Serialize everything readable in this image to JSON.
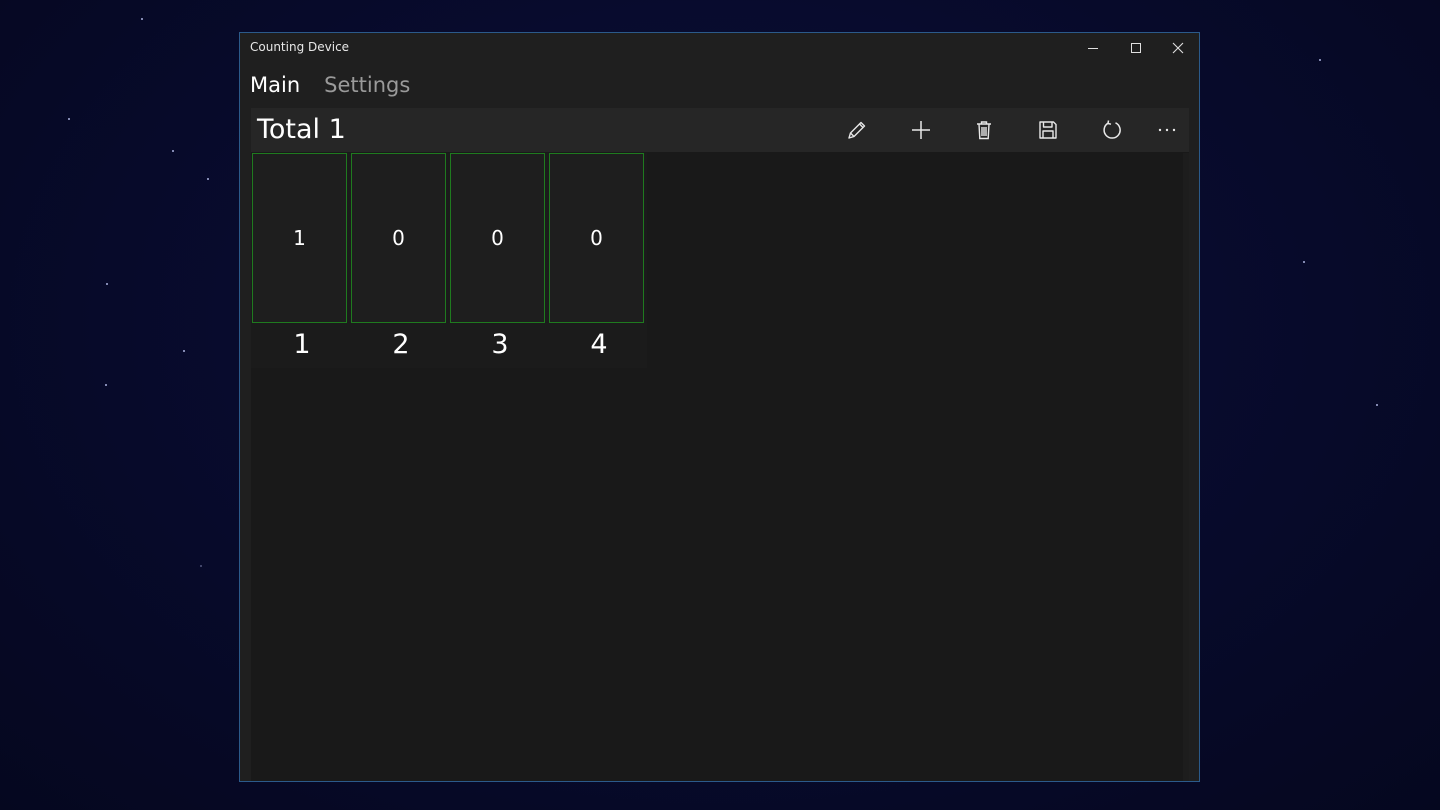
{
  "window": {
    "title": "Counting Device"
  },
  "nav": {
    "tabs": [
      {
        "label": "Main",
        "active": true
      },
      {
        "label": "Settings",
        "active": false
      }
    ]
  },
  "header": {
    "total_text": "Total 1"
  },
  "toolbar": {
    "icons": [
      "edit-icon",
      "add-icon",
      "delete-icon",
      "save-icon",
      "refresh-icon",
      "more-icon"
    ]
  },
  "counters": [
    {
      "value": "1",
      "label": "1"
    },
    {
      "value": "0",
      "label": "2"
    },
    {
      "value": "0",
      "label": "3"
    },
    {
      "value": "0",
      "label": "4"
    }
  ],
  "colors": {
    "counter_border": "#1f7a1f",
    "window_border": "#2b5a8a",
    "desktop_bg": "#070a2a"
  }
}
